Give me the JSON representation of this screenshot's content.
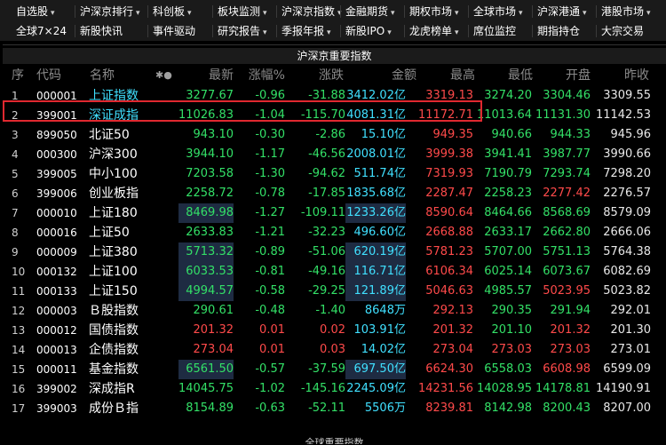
{
  "nav": {
    "row1": [
      {
        "label": "自选股",
        "caret": true
      },
      {
        "label": "沪深京排行",
        "caret": true
      },
      {
        "label": "科创板",
        "caret": true
      },
      {
        "label": "板块监测",
        "caret": true
      },
      {
        "label": "沪深京指数",
        "caret": true
      },
      {
        "label": "金融期货",
        "caret": true
      },
      {
        "label": "期权市场",
        "caret": true
      },
      {
        "label": "全球市场",
        "caret": true
      },
      {
        "label": "沪深港通",
        "caret": true
      },
      {
        "label": "港股市场",
        "caret": true
      }
    ],
    "row2": [
      {
        "label": "全球7×24"
      },
      {
        "label": "新股快讯"
      },
      {
        "label": "事件驱动"
      },
      {
        "label": "研究报告",
        "caret": true
      },
      {
        "label": "季报年报",
        "caret": true
      },
      {
        "label": "新股IPO",
        "caret": true
      },
      {
        "label": "龙虎榜单",
        "caret": true
      },
      {
        "label": "席位监控"
      },
      {
        "label": "期指持仓"
      },
      {
        "label": "大宗交易"
      }
    ]
  },
  "panel": {
    "title": "沪深京重要指数",
    "bottom_title": "全球重要指数"
  },
  "columns": {
    "seq": "序",
    "code": "代码",
    "name": "名称",
    "dots": "✱●",
    "latest": "最新",
    "pct": "涨幅%",
    "chg": "涨跌",
    "amount": "金额",
    "high": "最高",
    "low": "最低",
    "open": "开盘",
    "prev": "昨收"
  },
  "colors": {
    "green": "#33e067",
    "red": "#ff4a4a",
    "highlight_border": "#e0282f",
    "cyan": "#40e0ff"
  },
  "rows": [
    {
      "seq": "1",
      "code": "000001",
      "name": "上证指数",
      "latest": "3277.67",
      "pct": "-0.96",
      "chg": "-31.88",
      "amount": "3412.02",
      "unit": "亿",
      "high": "3319.13",
      "low": "3274.20",
      "open": "3304.46",
      "prev": "3309.55",
      "latest_c": "green",
      "high_c": "red",
      "low_c": "green",
      "open_c": "green",
      "name_c": "cyan",
      "hl": false
    },
    {
      "seq": "2",
      "code": "399001",
      "name": "深证成指",
      "latest": "11026.83",
      "pct": "-1.04",
      "chg": "-115.70",
      "amount": "4081.31",
      "unit": "亿",
      "high": "11172.71",
      "low": "11013.64",
      "open": "11131.30",
      "prev": "11142.53",
      "latest_c": "green",
      "high_c": "red",
      "low_c": "green",
      "open_c": "green",
      "name_c": "cyan",
      "hl": false
    },
    {
      "seq": "3",
      "code": "899050",
      "name": "北证50",
      "latest": "943.10",
      "pct": "-0.30",
      "chg": "-2.86",
      "amount": "15.10",
      "unit": "亿",
      "high": "949.35",
      "low": "940.66",
      "open": "944.33",
      "prev": "945.96",
      "latest_c": "green",
      "high_c": "red",
      "low_c": "green",
      "open_c": "green",
      "name_c": "white",
      "hl": false
    },
    {
      "seq": "4",
      "code": "000300",
      "name": "沪深300",
      "latest": "3944.10",
      "pct": "-1.17",
      "chg": "-46.56",
      "amount": "2008.01",
      "unit": "亿",
      "high": "3999.38",
      "low": "3941.41",
      "open": "3987.77",
      "prev": "3990.66",
      "latest_c": "green",
      "high_c": "red",
      "low_c": "green",
      "open_c": "green",
      "name_c": "white",
      "hl": false
    },
    {
      "seq": "5",
      "code": "399005",
      "name": "中小100",
      "latest": "7203.58",
      "pct": "-1.30",
      "chg": "-94.62",
      "amount": "511.74",
      "unit": "亿",
      "high": "7319.93",
      "low": "7190.79",
      "open": "7293.74",
      "prev": "7298.20",
      "latest_c": "green",
      "high_c": "red",
      "low_c": "green",
      "open_c": "green",
      "name_c": "white",
      "hl": false
    },
    {
      "seq": "6",
      "code": "399006",
      "name": "创业板指",
      "latest": "2258.72",
      "pct": "-0.78",
      "chg": "-17.85",
      "amount": "1835.68",
      "unit": "亿",
      "high": "2287.47",
      "low": "2258.23",
      "open": "2277.42",
      "prev": "2276.57",
      "latest_c": "green",
      "high_c": "red",
      "low_c": "green",
      "open_c": "red",
      "name_c": "white",
      "hl": false
    },
    {
      "seq": "7",
      "code": "000010",
      "name": "上证180",
      "latest": "8469.98",
      "pct": "-1.27",
      "chg": "-109.11",
      "amount": "1233.26",
      "unit": "亿",
      "high": "8590.64",
      "low": "8464.66",
      "open": "8568.69",
      "prev": "8579.09",
      "latest_c": "green",
      "high_c": "red",
      "low_c": "green",
      "open_c": "green",
      "name_c": "white",
      "hl": true
    },
    {
      "seq": "8",
      "code": "000016",
      "name": "上证50",
      "latest": "2633.83",
      "pct": "-1.21",
      "chg": "-32.23",
      "amount": "496.60",
      "unit": "亿",
      "high": "2668.88",
      "low": "2633.17",
      "open": "2662.80",
      "prev": "2666.06",
      "latest_c": "green",
      "high_c": "red",
      "low_c": "green",
      "open_c": "green",
      "name_c": "white",
      "hl": false
    },
    {
      "seq": "9",
      "code": "000009",
      "name": "上证380",
      "latest": "5713.32",
      "pct": "-0.89",
      "chg": "-51.06",
      "amount": "620.19",
      "unit": "亿",
      "high": "5781.23",
      "low": "5707.00",
      "open": "5751.13",
      "prev": "5764.38",
      "latest_c": "green",
      "high_c": "red",
      "low_c": "green",
      "open_c": "green",
      "name_c": "white",
      "hl": true
    },
    {
      "seq": "10",
      "code": "000132",
      "name": "上证100",
      "latest": "6033.53",
      "pct": "-0.81",
      "chg": "-49.16",
      "amount": "116.71",
      "unit": "亿",
      "high": "6106.34",
      "low": "6025.14",
      "open": "6073.67",
      "prev": "6082.69",
      "latest_c": "green",
      "high_c": "red",
      "low_c": "green",
      "open_c": "green",
      "name_c": "white",
      "hl": true
    },
    {
      "seq": "11",
      "code": "000133",
      "name": "上证150",
      "latest": "4994.57",
      "pct": "-0.58",
      "chg": "-29.25",
      "amount": "121.89",
      "unit": "亿",
      "high": "5046.63",
      "low": "4985.57",
      "open": "5023.95",
      "prev": "5023.82",
      "latest_c": "green",
      "high_c": "red",
      "low_c": "green",
      "open_c": "red",
      "name_c": "white",
      "hl": true
    },
    {
      "seq": "12",
      "code": "000003",
      "name": "Ｂ股指数",
      "latest": "290.61",
      "pct": "-0.48",
      "chg": "-1.40",
      "amount": "8648",
      "unit": "万",
      "high": "292.13",
      "low": "290.35",
      "open": "291.94",
      "prev": "292.01",
      "latest_c": "green",
      "high_c": "red",
      "low_c": "green",
      "open_c": "green",
      "name_c": "white",
      "hl": false
    },
    {
      "seq": "13",
      "code": "000012",
      "name": "国债指数",
      "latest": "201.32",
      "pct": "0.01",
      "chg": "0.02",
      "amount": "103.91",
      "unit": "亿",
      "high": "201.32",
      "low": "201.10",
      "open": "201.32",
      "prev": "201.30",
      "latest_c": "red",
      "high_c": "red",
      "low_c": "green",
      "open_c": "red",
      "name_c": "white",
      "hl": false,
      "up": true
    },
    {
      "seq": "14",
      "code": "000013",
      "name": "企债指数",
      "latest": "273.04",
      "pct": "0.01",
      "chg": "0.03",
      "amount": "14.02",
      "unit": "亿",
      "high": "273.04",
      "low": "273.03",
      "open": "273.03",
      "prev": "273.01",
      "latest_c": "red",
      "high_c": "red",
      "low_c": "red",
      "open_c": "red",
      "name_c": "white",
      "hl": false,
      "up": true
    },
    {
      "seq": "15",
      "code": "000011",
      "name": "基金指数",
      "latest": "6561.50",
      "pct": "-0.57",
      "chg": "-37.59",
      "amount": "697.50",
      "unit": "亿",
      "high": "6624.30",
      "low": "6558.03",
      "open": "6608.98",
      "prev": "6599.09",
      "latest_c": "green",
      "high_c": "red",
      "low_c": "green",
      "open_c": "red",
      "name_c": "white",
      "hl": true
    },
    {
      "seq": "16",
      "code": "399002",
      "name": "深成指R",
      "latest": "14045.75",
      "pct": "-1.02",
      "chg": "-145.16",
      "amount": "2245.09",
      "unit": "亿",
      "high": "14231.56",
      "low": "14028.95",
      "open": "14178.81",
      "prev": "14190.91",
      "latest_c": "green",
      "high_c": "red",
      "low_c": "green",
      "open_c": "green",
      "name_c": "white",
      "hl": false
    },
    {
      "seq": "17",
      "code": "399003",
      "name": "成份Ｂ指",
      "latest": "8154.89",
      "pct": "-0.63",
      "chg": "-52.11",
      "amount": "5506",
      "unit": "万",
      "high": "8239.81",
      "low": "8142.98",
      "open": "8200.43",
      "prev": "8207.00",
      "latest_c": "green",
      "high_c": "red",
      "low_c": "green",
      "open_c": "green",
      "name_c": "white",
      "hl": false
    }
  ]
}
